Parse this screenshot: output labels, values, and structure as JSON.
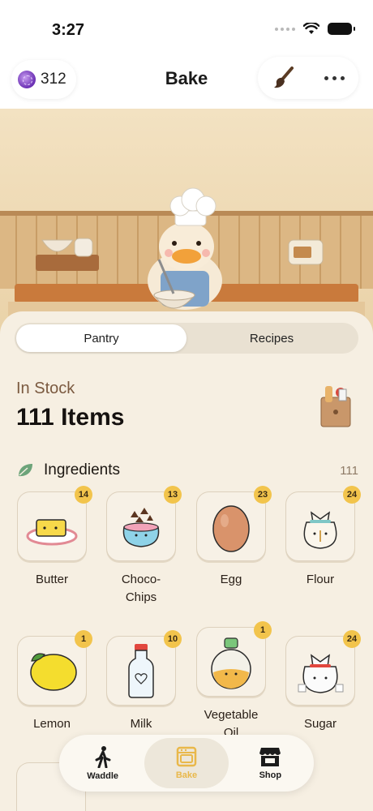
{
  "status": {
    "time": "3:27"
  },
  "header": {
    "gems": "312",
    "title": "Bake"
  },
  "tabs": [
    {
      "label": "Pantry",
      "active": true
    },
    {
      "label": "Recipes",
      "active": false
    }
  ],
  "stock": {
    "label": "In Stock",
    "count": "111 Items"
  },
  "section": {
    "title": "Ingredients",
    "count": "111"
  },
  "ingredients": [
    {
      "name": "Butter",
      "qty": "14",
      "icon": "butter-icon"
    },
    {
      "name": "Choco-\nChips",
      "qty": "13",
      "icon": "choco-chips-icon"
    },
    {
      "name": "Egg",
      "qty": "23",
      "icon": "egg-icon"
    },
    {
      "name": "Flour",
      "qty": "24",
      "icon": "flour-icon"
    },
    {
      "name": "Lemon",
      "qty": "1",
      "icon": "lemon-icon"
    },
    {
      "name": "Milk",
      "qty": "10",
      "icon": "milk-icon"
    },
    {
      "name": "Vegetable\nOil",
      "qty": "1",
      "icon": "vegetable-oil-icon"
    },
    {
      "name": "Sugar",
      "qty": "24",
      "icon": "sugar-icon"
    }
  ],
  "nav": [
    {
      "label": "Waddle",
      "icon": "walking-icon",
      "active": false
    },
    {
      "label": "Bake",
      "icon": "oven-icon",
      "active": true
    },
    {
      "label": "Shop",
      "icon": "store-icon",
      "active": false
    }
  ],
  "colors": {
    "accent": "#e9b84a",
    "badge": "#f2c44c",
    "background": "#f6efe2"
  }
}
